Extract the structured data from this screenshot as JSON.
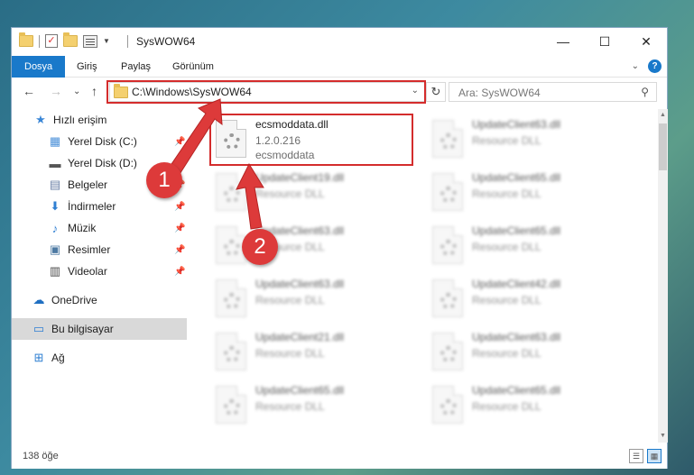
{
  "window": {
    "title": "SysWOW64",
    "controls": {
      "minimize": "—",
      "maximize": "☐",
      "close": "✕"
    }
  },
  "ribbon": {
    "tabs": [
      "Dosya",
      "Giriş",
      "Paylaş",
      "Görünüm"
    ],
    "help": "?",
    "expand": "⌄"
  },
  "navigation": {
    "back": "←",
    "forward": "→",
    "recent": "⌄",
    "up": "↑",
    "address": "C:\\Windows\\SysWOW64",
    "refresh": "↻",
    "search_placeholder": "Ara: SysWOW64"
  },
  "sidebar": {
    "items": [
      {
        "label": "Hızlı erişim",
        "icon": "star-icon",
        "glyph": "★",
        "color": "#3a86d6"
      },
      {
        "label": "Yerel Disk (C:)",
        "icon": "windows-drive-icon",
        "glyph": "▦",
        "color": "#4a90d9",
        "pinned": true
      },
      {
        "label": "Yerel Disk (D:)",
        "icon": "drive-icon",
        "glyph": "▬",
        "color": "#555555",
        "pinned": true
      },
      {
        "label": "Belgeler",
        "icon": "documents-icon",
        "glyph": "▤",
        "color": "#6a7fa6",
        "pinned": true
      },
      {
        "label": "İndirmeler",
        "icon": "download-icon",
        "glyph": "⬇",
        "color": "#2f7fd2",
        "pinned": true
      },
      {
        "label": "Müzik",
        "icon": "music-icon",
        "glyph": "♪",
        "color": "#2f7fd2",
        "pinned": true
      },
      {
        "label": "Resimler",
        "icon": "pictures-icon",
        "glyph": "▣",
        "color": "#4d7aa3",
        "pinned": true
      },
      {
        "label": "Videolar",
        "icon": "videos-icon",
        "glyph": "▥",
        "color": "#4a4a4a",
        "pinned": true
      },
      {
        "label": "OneDrive",
        "icon": "cloud-icon",
        "glyph": "☁",
        "color": "#1f6fc2"
      },
      {
        "label": "Bu bilgisayar",
        "icon": "computer-icon",
        "glyph": "▭",
        "color": "#2f7fd2",
        "selected": true
      },
      {
        "label": "Ağ",
        "icon": "network-icon",
        "glyph": "⊞",
        "color": "#2f7fd2"
      }
    ],
    "pin_glyph": "📌"
  },
  "files": [
    {
      "name": "ecsmoddata.dll",
      "version": "1.2.0.216",
      "desc": "ecsmoddata",
      "highlight": true
    },
    {
      "name": "UpdateClient63.dll",
      "version": "",
      "desc": "Resource DLL"
    },
    {
      "name": "UpdateClient19.dll",
      "version": "",
      "desc": "Resource DLL"
    },
    {
      "name": "UpdateClient65.dll",
      "version": "",
      "desc": "Resource DLL"
    },
    {
      "name": "UpdateClient63.dll",
      "version": "",
      "desc": "Resource DLL"
    },
    {
      "name": "UpdateClient65.dll",
      "version": "",
      "desc": "Resource DLL"
    },
    {
      "name": "UpdateClient63.dll",
      "version": "",
      "desc": "Resource DLL"
    },
    {
      "name": "UpdateClient42.dll",
      "version": "",
      "desc": "Resource DLL"
    },
    {
      "name": "UpdateClient21.dll",
      "version": "",
      "desc": "Resource DLL"
    },
    {
      "name": "UpdateClient63.dll",
      "version": "",
      "desc": "Resource DLL"
    },
    {
      "name": "UpdateClient65.dll",
      "version": "",
      "desc": "Resource DLL"
    },
    {
      "name": "UpdateClient65.dll",
      "version": "",
      "desc": "Resource DLL"
    }
  ],
  "status": {
    "count": "138 öğe"
  },
  "annotations": {
    "marker1": "1",
    "marker2": "2",
    "color": "#dd3a3a"
  }
}
